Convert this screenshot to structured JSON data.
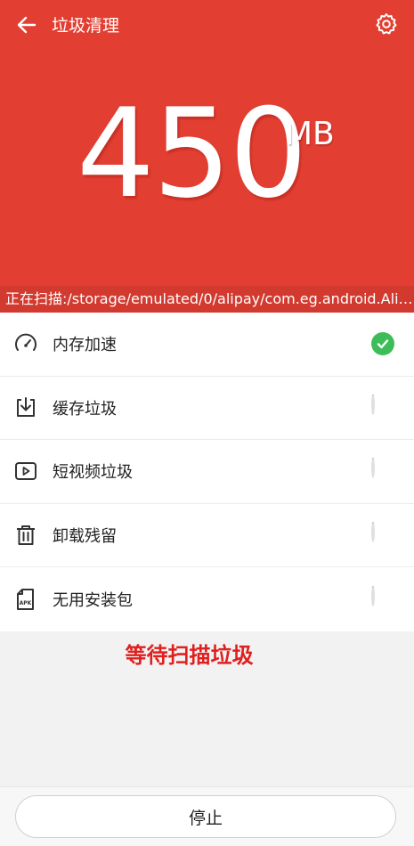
{
  "header": {
    "title": "垃圾清理",
    "back_icon": "arrow-left-icon",
    "settings_icon": "gear-icon",
    "background_color": "#e23f32"
  },
  "scan": {
    "size_value": "450",
    "size_unit": "MB",
    "status_text": "正在扫描:/storage/emulated/0/alipay/com.eg.android.Alipay..."
  },
  "items": [
    {
      "label": "内存加速",
      "icon": "speedometer-icon",
      "status": "done"
    },
    {
      "label": "缓存垃圾",
      "icon": "download-tray-icon",
      "status": "scanning"
    },
    {
      "label": "短视频垃圾",
      "icon": "video-play-icon",
      "status": "scanning"
    },
    {
      "label": "卸载残留",
      "icon": "trash-can-icon",
      "status": "scanning"
    },
    {
      "label": "无用安装包",
      "icon": "apk-file-icon",
      "status": "scanning"
    }
  ],
  "waiting_text": "等待扫描垃圾",
  "footer": {
    "stop_label": "停止"
  },
  "colors": {
    "accent_red": "#e23f32",
    "success_green": "#3dbd58",
    "annotation_red": "#e0201f"
  }
}
